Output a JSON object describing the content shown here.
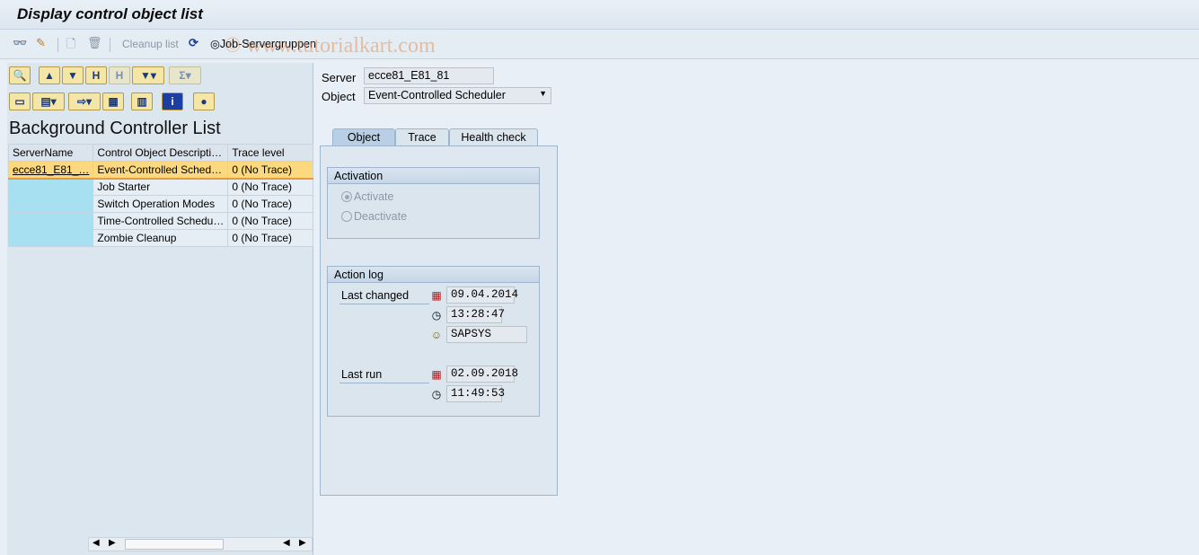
{
  "title": "Display control object list",
  "toolbar": {
    "cleanup_label": "Cleanup list",
    "job_server_label": "Job-Servergruppen"
  },
  "watermark": "© www.tutorialkart.com",
  "left": {
    "list_title": "Background Controller List",
    "columns": [
      "ServerName",
      "Control Object Descripti…",
      "Trace level"
    ],
    "rows": [
      {
        "server": "ecce81_E81_…",
        "desc": "Event-Controlled Sched…",
        "trace": "0 (No Trace)"
      },
      {
        "server": "",
        "desc": "Job Starter",
        "trace": "0 (No Trace)"
      },
      {
        "server": "",
        "desc": "Switch Operation Modes",
        "trace": "0 (No Trace)"
      },
      {
        "server": "",
        "desc": "Time-Controlled Schedu…",
        "trace": "0 (No Trace)"
      },
      {
        "server": "",
        "desc": "Zombie Cleanup",
        "trace": "0 (No Trace)"
      }
    ]
  },
  "detail": {
    "server_label": "Server",
    "server_value": "ecce81_E81_81",
    "object_label": "Object",
    "object_value": "Event-Controlled Scheduler",
    "tabs": [
      "Object",
      "Trace",
      "Health check"
    ],
    "activation": {
      "title": "Activation",
      "activate": "Activate",
      "deactivate": "Deactivate",
      "selected": "Activate"
    },
    "action_log": {
      "title": "Action log",
      "last_changed_label": "Last changed",
      "last_changed_date": "09.04.2014",
      "last_changed_time": "13:28:47",
      "user": "SAPSYS",
      "last_run_label": "Last run",
      "last_run_date": "02.09.2018",
      "last_run_time": "11:49:53"
    }
  }
}
